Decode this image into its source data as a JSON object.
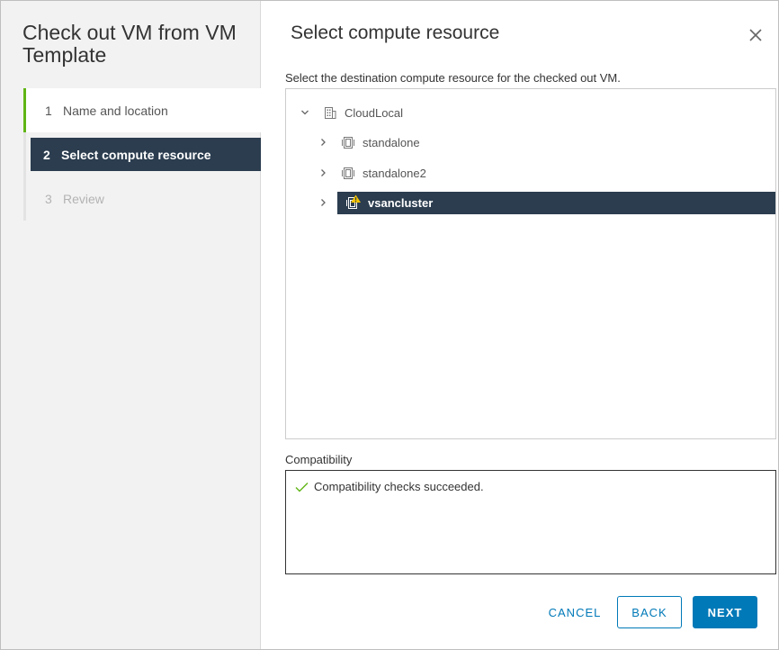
{
  "wizard": {
    "title": "Check out VM from VM Template",
    "steps": [
      {
        "number": "1",
        "label": "Name and location",
        "state": "completed"
      },
      {
        "number": "2",
        "label": "Select compute resource",
        "state": "active"
      },
      {
        "number": "3",
        "label": "Review",
        "state": "disabled"
      }
    ]
  },
  "page": {
    "title": "Select compute resource",
    "instruction": "Select the destination compute resource for the checked out VM."
  },
  "tree": {
    "root": {
      "label": "CloudLocal",
      "icon": "datacenter-icon",
      "expanded": true
    },
    "children": [
      {
        "label": "standalone",
        "icon": "host-icon",
        "selected": false
      },
      {
        "label": "standalone2",
        "icon": "host-icon",
        "selected": false
      },
      {
        "label": "vsancluster",
        "icon": "cluster-warning-icon",
        "selected": true
      }
    ]
  },
  "compatibility": {
    "label": "Compatibility",
    "message": "Compatibility checks succeeded.",
    "status_color": "#60b515"
  },
  "buttons": {
    "cancel": "CANCEL",
    "back": "BACK",
    "next": "NEXT"
  },
  "colors": {
    "accent": "#0079b8",
    "selected": "#2b3d4f",
    "completed_step": "#60b515"
  }
}
